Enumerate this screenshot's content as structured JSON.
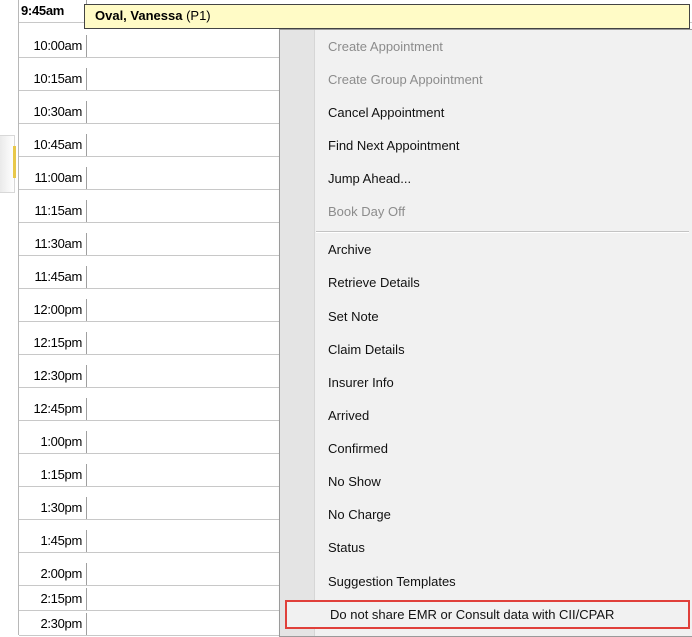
{
  "schedule": {
    "rows": [
      {
        "time": "9:45am"
      },
      {
        "time": "10:00am"
      },
      {
        "time": "10:15am"
      },
      {
        "time": "10:30am"
      },
      {
        "time": "10:45am"
      },
      {
        "time": "11:00am"
      },
      {
        "time": "11:15am"
      },
      {
        "time": "11:30am"
      },
      {
        "time": "11:45am"
      },
      {
        "time": "12:00pm"
      },
      {
        "time": "12:15pm"
      },
      {
        "time": "12:30pm"
      },
      {
        "time": "12:45pm"
      },
      {
        "time": "1:00pm"
      },
      {
        "time": "1:15pm"
      },
      {
        "time": "1:30pm"
      },
      {
        "time": "1:45pm"
      },
      {
        "time": "2:00pm"
      },
      {
        "time": "2:15pm"
      },
      {
        "time": "2:30pm"
      }
    ],
    "appointment": {
      "patient_name": "Oval, Vanessa",
      "provider_code": "(P1)",
      "color": "#fffbc6"
    }
  },
  "context_menu": {
    "items": [
      {
        "label": "Create Appointment",
        "enabled": false
      },
      {
        "label": "Create Group Appointment",
        "enabled": false
      },
      {
        "label": "Cancel Appointment",
        "enabled": true
      },
      {
        "label": "Find Next Appointment",
        "enabled": true
      },
      {
        "label": "Jump Ahead...",
        "enabled": true
      },
      {
        "label": "Book Day Off",
        "enabled": false
      },
      {
        "label": "Archive",
        "enabled": true
      },
      {
        "label": "Retrieve Details",
        "enabled": true
      },
      {
        "label": "Set Note",
        "enabled": true
      },
      {
        "label": "Claim Details",
        "enabled": true
      },
      {
        "label": "Insurer Info",
        "enabled": true
      },
      {
        "label": "Arrived",
        "enabled": true
      },
      {
        "label": "Confirmed",
        "enabled": true
      },
      {
        "label": "No Show",
        "enabled": true
      },
      {
        "label": "No Charge",
        "enabled": true
      },
      {
        "label": "Status",
        "enabled": true
      },
      {
        "label": "Suggestion Templates",
        "enabled": true
      },
      {
        "label": "Do not share EMR or Consult data with CII/CPAR",
        "enabled": true,
        "highlighted": true
      }
    ],
    "highlight_color": "#e0403a"
  }
}
